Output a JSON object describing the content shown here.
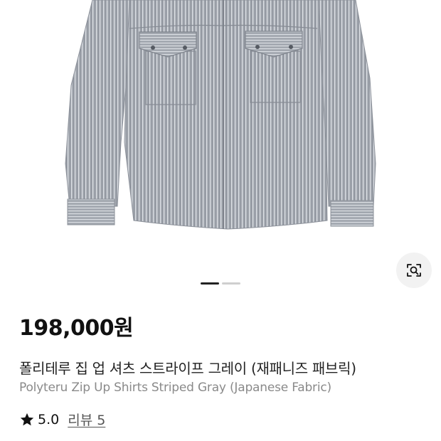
{
  "product": {
    "price": "198,000원",
    "title_ko": "폴리테루 집 업 셔츠 스트라이프 그레이 (재패니즈 패브릭)",
    "title_en": "Polyteru Zip Up Shirts Striped Gray (Japanese Fabric)",
    "rating": "5.0",
    "review_label": "리뷰 5"
  },
  "gallery": {
    "current_index": 1,
    "total": 2,
    "lens_icon": "image-search-icon"
  },
  "colors": {
    "shirt": "#9ea3ab",
    "stripe": "#d9dde2",
    "price_text": "#111111",
    "subtitle_text": "#8a8a8a",
    "pager_active": "#222222",
    "pager_inactive": "#cfcfcf"
  }
}
